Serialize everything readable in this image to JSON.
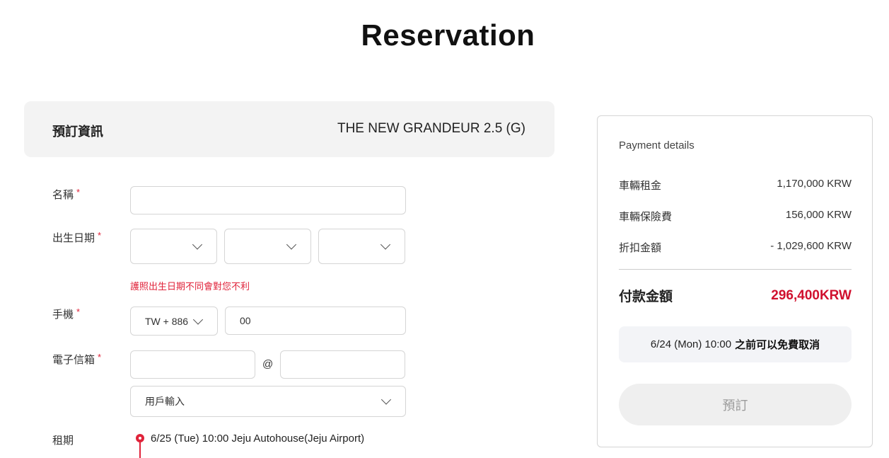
{
  "page": {
    "title": "Reservation"
  },
  "info": {
    "label": "預訂資訊",
    "car": "THE NEW GRANDEUR 2.5 (G)"
  },
  "form": {
    "required_mark": "*",
    "name_label": "名稱",
    "name_value": "",
    "birth_label": "出生日期",
    "birth_year": "",
    "birth_month": "",
    "birth_day": "",
    "birth_warning": "護照出生日期不同會對您不利",
    "phone_label": "手機",
    "phone_country": "TW + 886",
    "phone_value": "00",
    "email_label": "電子信箱",
    "email_user": "",
    "email_at": "@",
    "email_domain": "",
    "email_domain_select": "用戶輸入",
    "period_label": "租期",
    "period_start": "6/25 (Tue) 10:00 Jeju Autohouse(Jeju Airport)"
  },
  "payment": {
    "title": "Payment details",
    "rows": [
      {
        "label": "車輛租金",
        "value": "1,170,000 KRW"
      },
      {
        "label": "車輛保險費",
        "value": "156,000 KRW"
      },
      {
        "label": "折扣金額",
        "value": "- 1,029,600 KRW"
      }
    ],
    "total_label": "付款金額",
    "total_value": "296,400KRW",
    "cancel_date": "6/24 (Mon) 10:00",
    "cancel_text": "之前可以免費取消",
    "reserve_button": "預訂"
  },
  "colors": {
    "accent": "#d0102e",
    "required": "#e0233a"
  },
  "icons": {
    "select": "chevron-down-icon",
    "location": "location-pin-icon"
  }
}
